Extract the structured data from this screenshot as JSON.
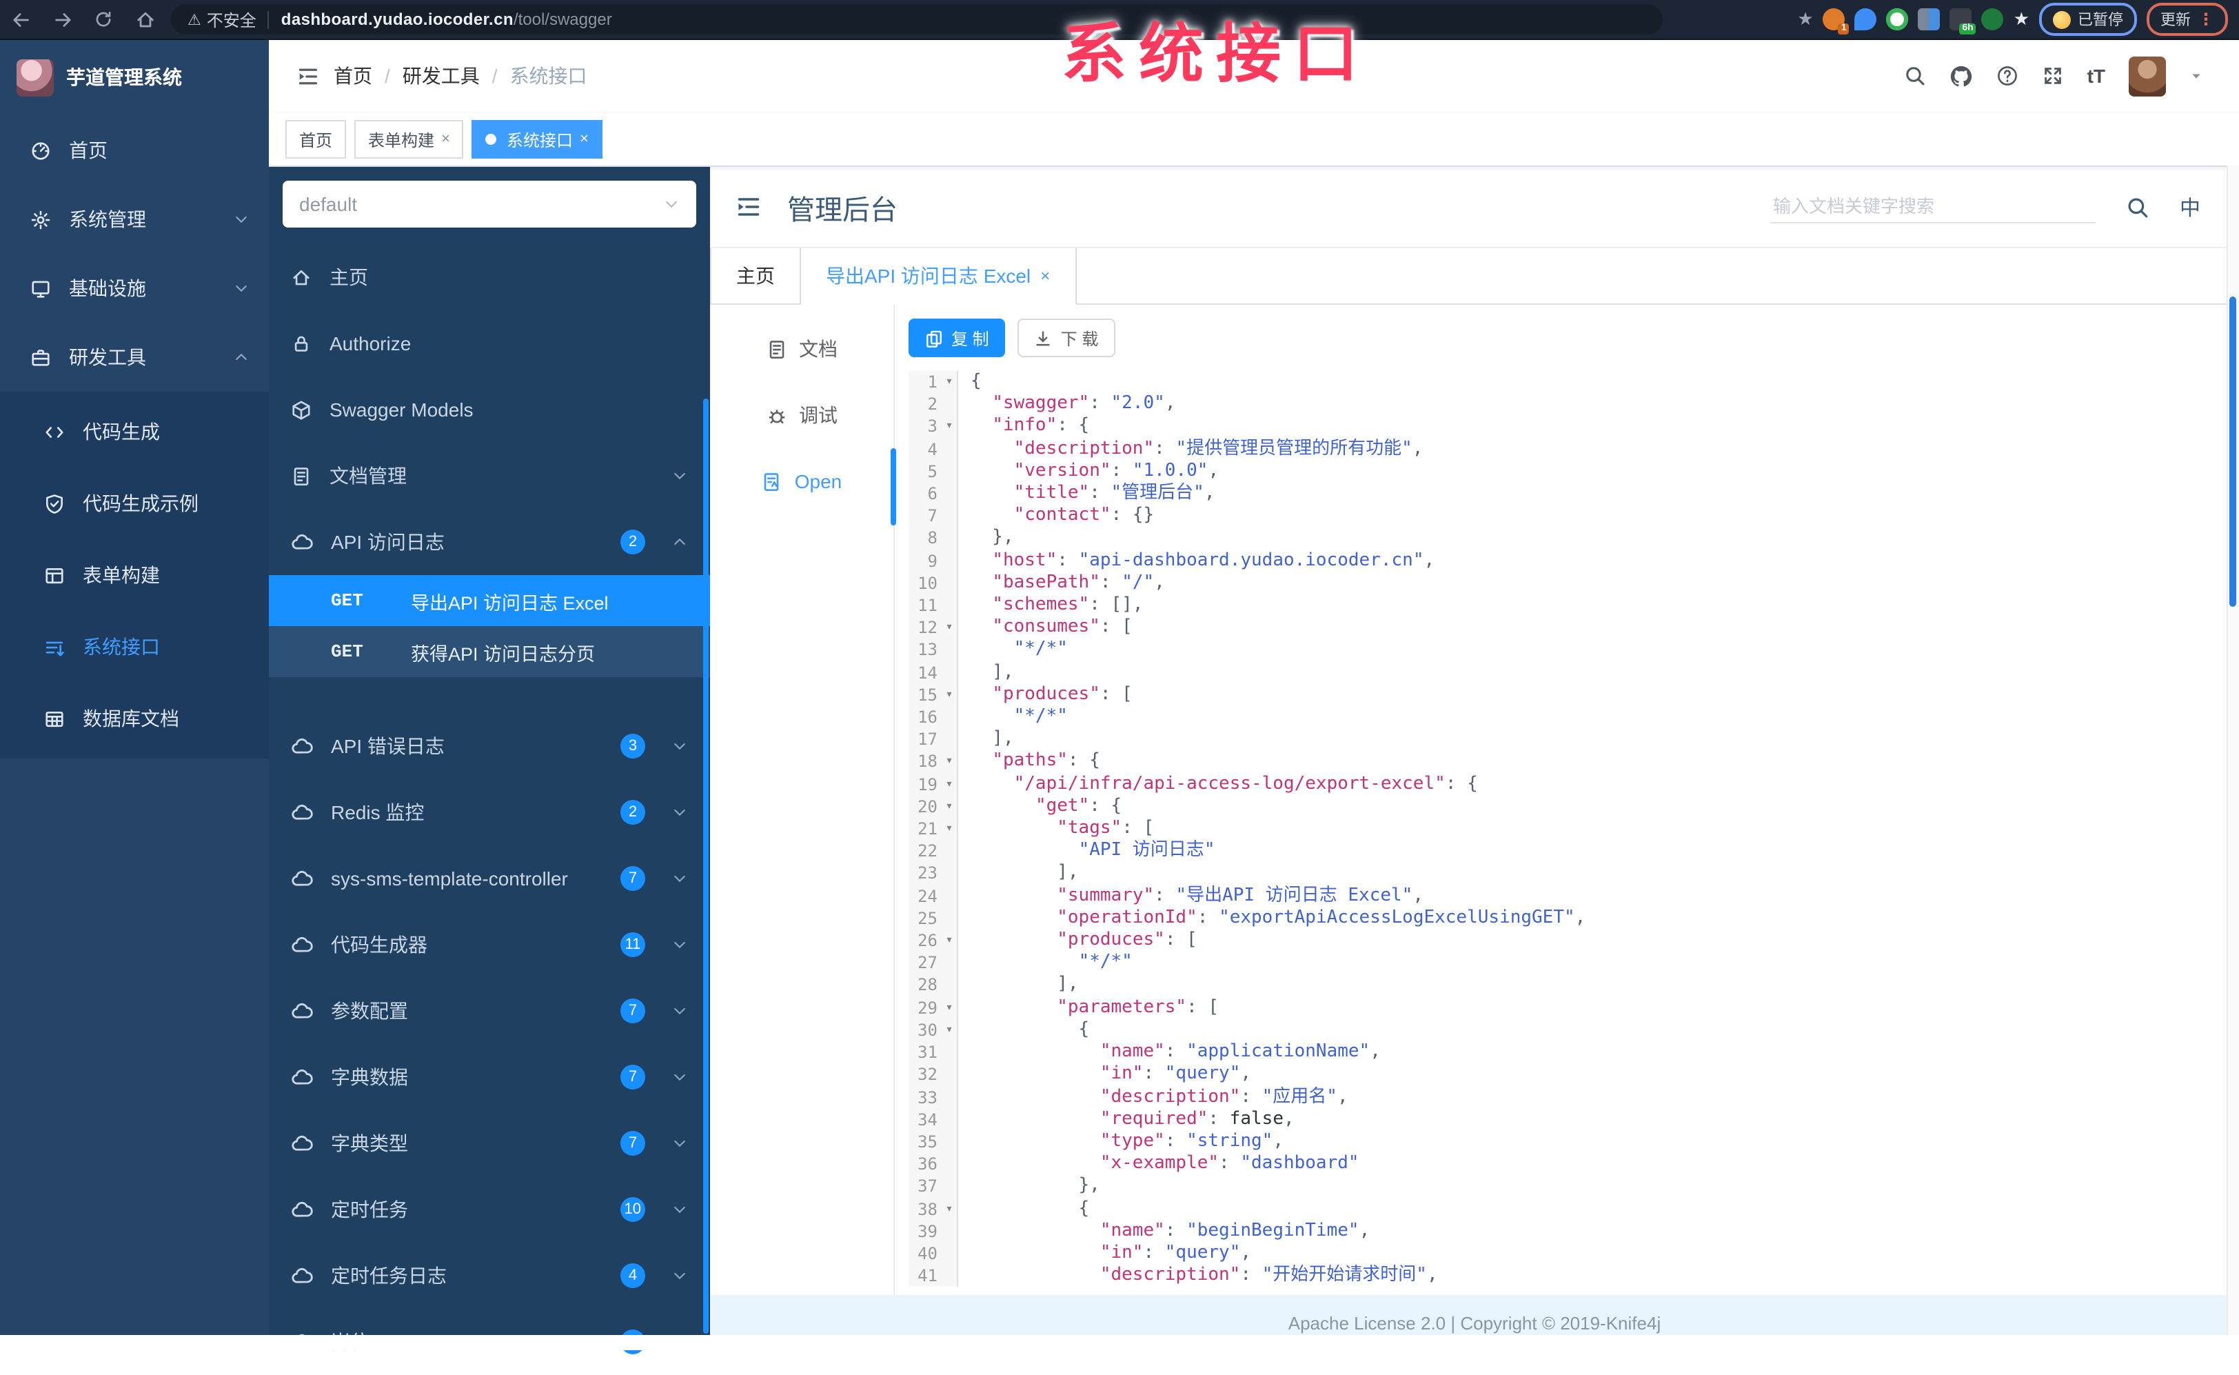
{
  "watermark": "系统接口",
  "browser": {
    "security_label": "不安全",
    "url_host": "dashboard.yudao.iocoder.cn",
    "url_path": "/tool/swagger",
    "ext_badge_1": "1",
    "ext_badge_6h": "6h",
    "paused_label": "已暂停",
    "update_label": "更新",
    "kebab": "⋮"
  },
  "sidebar": {
    "app_title": "芋道管理系统",
    "items": [
      {
        "label": "首页",
        "icon": "dashboard-icon",
        "chevron": ""
      },
      {
        "label": "系统管理",
        "icon": "gear-icon",
        "chevron": "down"
      },
      {
        "label": "基础设施",
        "icon": "monitor-icon",
        "chevron": "down"
      },
      {
        "label": "研发工具",
        "icon": "briefcase-icon",
        "chevron": "up"
      }
    ],
    "submenu": [
      {
        "label": "代码生成",
        "icon": "code-icon",
        "active": false
      },
      {
        "label": "代码生成示例",
        "icon": "shield-icon",
        "active": false
      },
      {
        "label": "表单构建",
        "icon": "form-icon",
        "active": false
      },
      {
        "label": "系统接口",
        "icon": "api-icon",
        "active": true
      },
      {
        "label": "数据库文档",
        "icon": "db-icon",
        "active": false
      }
    ]
  },
  "header": {
    "breadcrumb": [
      "首页",
      "研发工具",
      "系统接口"
    ],
    "breadcrumb_separator": "/",
    "text_size_icon": "tT",
    "lang_icon": "中"
  },
  "tags": [
    {
      "label": "首页",
      "closable": false,
      "active": false
    },
    {
      "label": "表单构建",
      "closable": true,
      "active": false
    },
    {
      "label": "系统接口",
      "closable": true,
      "active": true
    }
  ],
  "swagger": {
    "group_select_value": "default",
    "nav": [
      {
        "label": "主页",
        "icon": "home-icon",
        "badge": "",
        "chevron": ""
      },
      {
        "label": "Authorize",
        "icon": "lock-icon",
        "badge": "",
        "chevron": ""
      },
      {
        "label": "Swagger Models",
        "icon": "cube-icon",
        "badge": "",
        "chevron": ""
      },
      {
        "label": "文档管理",
        "icon": "doc-icon",
        "badge": "",
        "chevron": "down"
      },
      {
        "label": "API 访问日志",
        "icon": "cloud-icon",
        "badge": "2",
        "chevron": "up"
      }
    ],
    "endpoints": [
      {
        "method": "GET",
        "label": "导出API 访问日志 Excel",
        "active": true
      },
      {
        "method": "GET",
        "label": "获得API 访问日志分页",
        "active": false
      }
    ],
    "groups": [
      {
        "label": "API 错误日志",
        "badge": "3"
      },
      {
        "label": "Redis 监控",
        "badge": "2"
      },
      {
        "label": "sys-sms-template-controller",
        "badge": "7"
      },
      {
        "label": "代码生成器",
        "badge": "11"
      },
      {
        "label": "参数配置",
        "badge": "7"
      },
      {
        "label": "字典数据",
        "badge": "7"
      },
      {
        "label": "字典类型",
        "badge": "7"
      },
      {
        "label": "定时任务",
        "badge": "10"
      },
      {
        "label": "定时任务日志",
        "badge": "4"
      },
      {
        "label": "岗位",
        "badge": ""
      }
    ]
  },
  "content": {
    "title": "管理后台",
    "search_placeholder": "输入文档关键字搜索",
    "doc_tabs": [
      {
        "label": "主页",
        "closable": false,
        "active": false
      },
      {
        "label": "导出API 访问日志 Excel",
        "closable": true,
        "active": true
      }
    ],
    "doc_nav": [
      {
        "label": "文档",
        "icon": "doc-icon",
        "active": false
      },
      {
        "label": "调试",
        "icon": "bug-icon",
        "active": false
      },
      {
        "label": "Open",
        "icon": "open-icon",
        "active": true
      }
    ],
    "copy_label": "复 制",
    "download_label": "下 载",
    "footer": "Apache License 2.0 | Copyright © 2019-Knife4j"
  },
  "colors": {
    "accent_blue": "#1890ff",
    "active_blue": "#409eff",
    "sidebar_navy": "#254468",
    "panel_navy": "#204061",
    "watermark_pink": "#fb3a5e",
    "footer_bg": "#e9f5fe",
    "code_key": "#c2337a",
    "code_string": "#3f63d4"
  },
  "code": {
    "lines": [
      {
        "fold": true,
        "parts": [
          [
            "p",
            "{"
          ]
        ]
      },
      {
        "fold": false,
        "parts": [
          [
            "p",
            "  "
          ],
          [
            "k",
            "\"swagger\""
          ],
          [
            "p",
            ": "
          ],
          [
            "s",
            "\"2.0\""
          ],
          [
            "p",
            ","
          ]
        ]
      },
      {
        "fold": true,
        "parts": [
          [
            "p",
            "  "
          ],
          [
            "k",
            "\"info\""
          ],
          [
            "p",
            ": {"
          ]
        ]
      },
      {
        "fold": false,
        "parts": [
          [
            "p",
            "    "
          ],
          [
            "k",
            "\"description\""
          ],
          [
            "p",
            ": "
          ],
          [
            "s",
            "\"提供管理员管理的所有功能\""
          ],
          [
            "p",
            ","
          ]
        ]
      },
      {
        "fold": false,
        "parts": [
          [
            "p",
            "    "
          ],
          [
            "k",
            "\"version\""
          ],
          [
            "p",
            ": "
          ],
          [
            "s",
            "\"1.0.0\""
          ],
          [
            "p",
            ","
          ]
        ]
      },
      {
        "fold": false,
        "parts": [
          [
            "p",
            "    "
          ],
          [
            "k",
            "\"title\""
          ],
          [
            "p",
            ": "
          ],
          [
            "s",
            "\"管理后台\""
          ],
          [
            "p",
            ","
          ]
        ]
      },
      {
        "fold": false,
        "parts": [
          [
            "p",
            "    "
          ],
          [
            "k",
            "\"contact\""
          ],
          [
            "p",
            ": {}"
          ]
        ]
      },
      {
        "fold": false,
        "parts": [
          [
            "p",
            "  },"
          ]
        ]
      },
      {
        "fold": false,
        "parts": [
          [
            "p",
            "  "
          ],
          [
            "k",
            "\"host\""
          ],
          [
            "p",
            ": "
          ],
          [
            "s",
            "\"api-dashboard.yudao.iocoder.cn\""
          ],
          [
            "p",
            ","
          ]
        ]
      },
      {
        "fold": false,
        "parts": [
          [
            "p",
            "  "
          ],
          [
            "k",
            "\"basePath\""
          ],
          [
            "p",
            ": "
          ],
          [
            "s",
            "\"/\""
          ],
          [
            "p",
            ","
          ]
        ]
      },
      {
        "fold": false,
        "parts": [
          [
            "p",
            "  "
          ],
          [
            "k",
            "\"schemes\""
          ],
          [
            "p",
            ": [],"
          ]
        ]
      },
      {
        "fold": true,
        "parts": [
          [
            "p",
            "  "
          ],
          [
            "k",
            "\"consumes\""
          ],
          [
            "p",
            ": ["
          ]
        ]
      },
      {
        "fold": false,
        "parts": [
          [
            "p",
            "    "
          ],
          [
            "s",
            "\"*/*\""
          ]
        ]
      },
      {
        "fold": false,
        "parts": [
          [
            "p",
            "  ],"
          ]
        ]
      },
      {
        "fold": true,
        "parts": [
          [
            "p",
            "  "
          ],
          [
            "k",
            "\"produces\""
          ],
          [
            "p",
            ": ["
          ]
        ]
      },
      {
        "fold": false,
        "parts": [
          [
            "p",
            "    "
          ],
          [
            "s",
            "\"*/*\""
          ]
        ]
      },
      {
        "fold": false,
        "parts": [
          [
            "p",
            "  ],"
          ]
        ]
      },
      {
        "fold": true,
        "parts": [
          [
            "p",
            "  "
          ],
          [
            "k",
            "\"paths\""
          ],
          [
            "p",
            ": {"
          ]
        ]
      },
      {
        "fold": true,
        "parts": [
          [
            "p",
            "    "
          ],
          [
            "k",
            "\"/api/infra/api-access-log/export-excel\""
          ],
          [
            "p",
            ": {"
          ]
        ]
      },
      {
        "fold": true,
        "parts": [
          [
            "p",
            "      "
          ],
          [
            "k",
            "\"get\""
          ],
          [
            "p",
            ": {"
          ]
        ]
      },
      {
        "fold": true,
        "parts": [
          [
            "p",
            "        "
          ],
          [
            "k",
            "\"tags\""
          ],
          [
            "p",
            ": ["
          ]
        ]
      },
      {
        "fold": false,
        "parts": [
          [
            "p",
            "          "
          ],
          [
            "s",
            "\"API 访问日志\""
          ]
        ]
      },
      {
        "fold": false,
        "parts": [
          [
            "p",
            "        ],"
          ]
        ]
      },
      {
        "fold": false,
        "parts": [
          [
            "p",
            "        "
          ],
          [
            "k",
            "\"summary\""
          ],
          [
            "p",
            ": "
          ],
          [
            "s",
            "\"导出API 访问日志 Excel\""
          ],
          [
            "p",
            ","
          ]
        ]
      },
      {
        "fold": false,
        "parts": [
          [
            "p",
            "        "
          ],
          [
            "k",
            "\"operationId\""
          ],
          [
            "p",
            ": "
          ],
          [
            "s",
            "\"exportApiAccessLogExcelUsingGET\""
          ],
          [
            "p",
            ","
          ]
        ]
      },
      {
        "fold": true,
        "parts": [
          [
            "p",
            "        "
          ],
          [
            "k",
            "\"produces\""
          ],
          [
            "p",
            ": ["
          ]
        ]
      },
      {
        "fold": false,
        "parts": [
          [
            "p",
            "          "
          ],
          [
            "s",
            "\"*/*\""
          ]
        ]
      },
      {
        "fold": false,
        "parts": [
          [
            "p",
            "        ],"
          ]
        ]
      },
      {
        "fold": true,
        "parts": [
          [
            "p",
            "        "
          ],
          [
            "k",
            "\"parameters\""
          ],
          [
            "p",
            ": ["
          ]
        ]
      },
      {
        "fold": true,
        "parts": [
          [
            "p",
            "          {"
          ]
        ]
      },
      {
        "fold": false,
        "parts": [
          [
            "p",
            "            "
          ],
          [
            "k",
            "\"name\""
          ],
          [
            "p",
            ": "
          ],
          [
            "s",
            "\"applicationName\""
          ],
          [
            "p",
            ","
          ]
        ]
      },
      {
        "fold": false,
        "parts": [
          [
            "p",
            "            "
          ],
          [
            "k",
            "\"in\""
          ],
          [
            "p",
            ": "
          ],
          [
            "s",
            "\"query\""
          ],
          [
            "p",
            ","
          ]
        ]
      },
      {
        "fold": false,
        "parts": [
          [
            "p",
            "            "
          ],
          [
            "k",
            "\"description\""
          ],
          [
            "p",
            ": "
          ],
          [
            "s",
            "\"应用名\""
          ],
          [
            "p",
            ","
          ]
        ]
      },
      {
        "fold": false,
        "parts": [
          [
            "p",
            "            "
          ],
          [
            "k",
            "\"required\""
          ],
          [
            "p",
            ": "
          ],
          [
            "a",
            "false"
          ],
          [
            "p",
            ","
          ]
        ]
      },
      {
        "fold": false,
        "parts": [
          [
            "p",
            "            "
          ],
          [
            "k",
            "\"type\""
          ],
          [
            "p",
            ": "
          ],
          [
            "s",
            "\"string\""
          ],
          [
            "p",
            ","
          ]
        ]
      },
      {
        "fold": false,
        "parts": [
          [
            "p",
            "            "
          ],
          [
            "k",
            "\"x-example\""
          ],
          [
            "p",
            ": "
          ],
          [
            "s",
            "\"dashboard\""
          ]
        ]
      },
      {
        "fold": false,
        "parts": [
          [
            "p",
            "          },"
          ]
        ]
      },
      {
        "fold": true,
        "parts": [
          [
            "p",
            "          {"
          ]
        ]
      },
      {
        "fold": false,
        "parts": [
          [
            "p",
            "            "
          ],
          [
            "k",
            "\"name\""
          ],
          [
            "p",
            ": "
          ],
          [
            "s",
            "\"beginBeginTime\""
          ],
          [
            "p",
            ","
          ]
        ]
      },
      {
        "fold": false,
        "parts": [
          [
            "p",
            "            "
          ],
          [
            "k",
            "\"in\""
          ],
          [
            "p",
            ": "
          ],
          [
            "s",
            "\"query\""
          ],
          [
            "p",
            ","
          ]
        ]
      },
      {
        "fold": false,
        "parts": [
          [
            "p",
            "            "
          ],
          [
            "k",
            "\"description\""
          ],
          [
            "p",
            ": "
          ],
          [
            "s",
            "\"开始开始请求时间\""
          ],
          [
            "p",
            ","
          ]
        ]
      }
    ]
  }
}
